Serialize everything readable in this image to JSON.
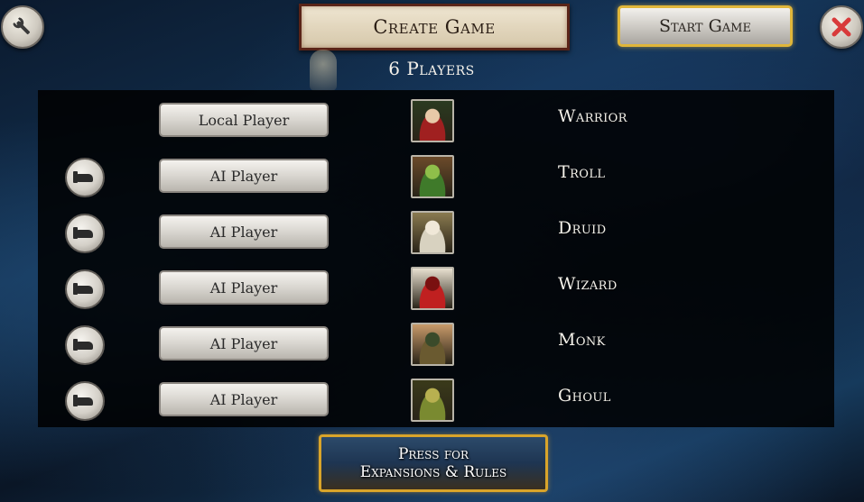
{
  "header": {
    "title": "Create Game",
    "start_label": "Start Game",
    "player_count": "6 Players"
  },
  "players": [
    {
      "type": "Local Player",
      "character": "Warrior",
      "removable": false,
      "colors": [
        "#a02020",
        "#2a3a20",
        "#e8c9a8"
      ]
    },
    {
      "type": "AI Player",
      "character": "Troll",
      "removable": true,
      "colors": [
        "#3f7a2a",
        "#6b4a2a",
        "#8fbf4a"
      ]
    },
    {
      "type": "AI Player",
      "character": "Druid",
      "removable": true,
      "colors": [
        "#d8d2c0",
        "#8a7a50",
        "#f0e8d8"
      ]
    },
    {
      "type": "AI Player",
      "character": "Wizard",
      "removable": true,
      "colors": [
        "#c02020",
        "#e8e0d0",
        "#7a1010"
      ]
    },
    {
      "type": "AI Player",
      "character": "Monk",
      "removable": true,
      "colors": [
        "#6a5a30",
        "#c89a6a",
        "#3a4a2a"
      ]
    },
    {
      "type": "AI Player",
      "character": "Ghoul",
      "removable": true,
      "colors": [
        "#7a8a30",
        "#3a3a1a",
        "#b8b050"
      ]
    }
  ],
  "footer": {
    "line1": "Press for",
    "line2": "Expansions & Rules"
  },
  "icons": {
    "settings": "wrench-icon",
    "close": "close-icon",
    "remove": "remove-player-icon"
  },
  "colors": {
    "accent_gold": "#d9a42a",
    "banner_border": "#5a2418",
    "close_x": "#d83a3a"
  }
}
